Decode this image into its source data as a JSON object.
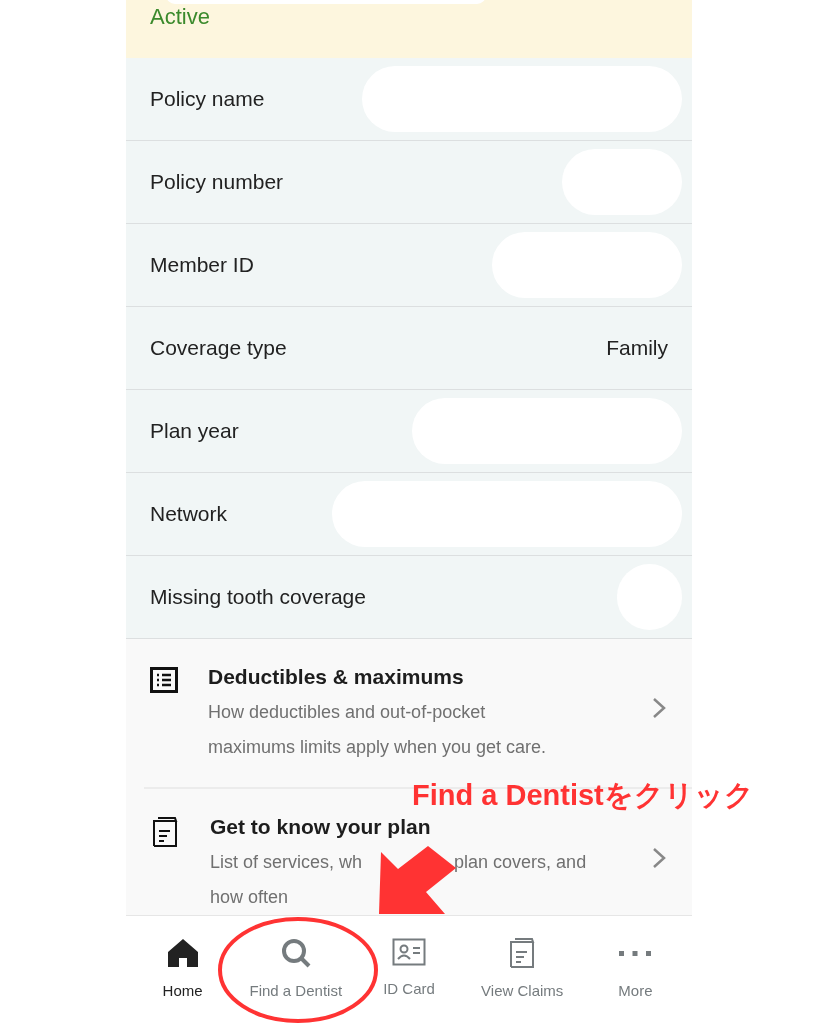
{
  "status": {
    "label": "Active"
  },
  "details": [
    {
      "label": "Policy name",
      "redacted": true
    },
    {
      "label": "Policy number",
      "redacted": true
    },
    {
      "label": "Member ID",
      "redacted": true
    },
    {
      "label": "Coverage type",
      "redacted": false,
      "value": "Family"
    },
    {
      "label": "Plan year",
      "redacted": true
    },
    {
      "label": "Network",
      "redacted": true
    },
    {
      "label": "Missing tooth coverage",
      "redacted": true
    }
  ],
  "links": [
    {
      "kind": "list",
      "title": "Deductibles & maximums",
      "lines": [
        [
          "How deductibles and out-of-pocket"
        ],
        [
          "maximums limits apply when you get care."
        ]
      ]
    },
    {
      "kind": "document",
      "title": "Get to know your plan",
      "lines": [
        [
          "List of services, wh",
          "plan covers, and"
        ],
        [
          "how often"
        ]
      ]
    }
  ],
  "tab_bar": [
    {
      "kind": "home",
      "label": "Home",
      "selected": true
    },
    {
      "kind": "search",
      "label": "Find a Dentist",
      "selected": false
    },
    {
      "kind": "idcard",
      "label": "ID Card",
      "selected": false
    },
    {
      "kind": "claims",
      "label": "View Claims",
      "selected": false
    },
    {
      "kind": "more",
      "label": "More",
      "selected": false
    }
  ],
  "annotation": {
    "text": "Find a Dentistをクリック"
  }
}
